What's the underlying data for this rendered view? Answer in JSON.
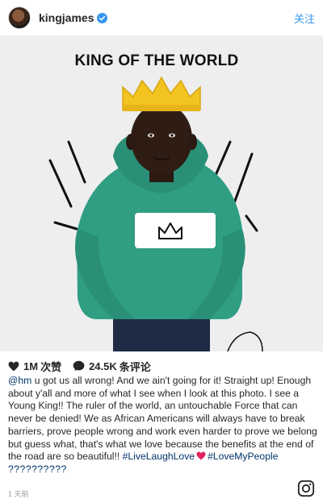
{
  "post": {
    "username": "kingjames",
    "follow_label": "关注",
    "photo": {
      "headline": "KING OF THE WORLD"
    },
    "likes_count": "1M",
    "likes_label": "次赞",
    "comments_count": "24.5K",
    "comments_label": "条评论",
    "caption": {
      "mention": "@hm",
      "body": " u got us all wrong! And we ain't going for it! Straight up! Enough about y'all and more of what I see when I look at this photo. I see a Young King!! The ruler of the world, an untouchable Force that can never be denied! We as African Americans will always have to break barriers, prove people wrong and work even harder to prove we belong but guess what, that's what we love because the benefits at the end of the road are so beautiful!! ",
      "hashtag1": "#LiveLaughLove",
      "hashtag2": "#LoveMyPeople",
      "trailing": "??????????"
    },
    "timestamp": "1 天前"
  },
  "colors": {
    "accent": "#3897f0",
    "link": "#003569",
    "hoodie": "#2f9e83"
  },
  "icons": [
    "verified-badge-icon",
    "heart-icon",
    "comment-bubble-icon",
    "instagram-icon"
  ]
}
